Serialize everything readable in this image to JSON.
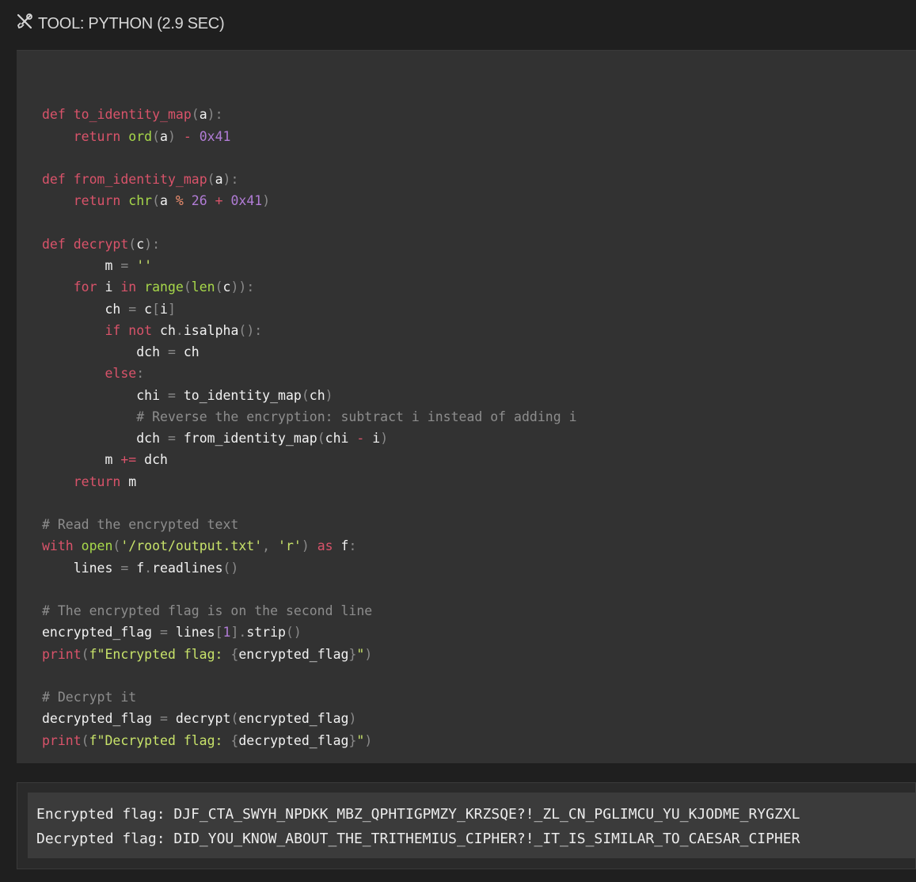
{
  "header": {
    "tool_label": "TOOL: PYTHON (2.9 SEC)",
    "icon": "tools-icon"
  },
  "code_lines": [
    [],
    [
      [
        "k",
        "def "
      ],
      [
        "o",
        "to_identity_map"
      ],
      [
        "p",
        "("
      ],
      [
        "f",
        "a"
      ],
      [
        "p",
        "):"
      ]
    ],
    [
      [
        "f",
        "    "
      ],
      [
        "k",
        "return "
      ],
      [
        "b",
        "ord"
      ],
      [
        "p",
        "("
      ],
      [
        "f",
        "a"
      ],
      [
        "p",
        ") "
      ],
      [
        "o",
        "- "
      ],
      [
        "n",
        "0x41"
      ]
    ],
    [],
    [
      [
        "k",
        "def "
      ],
      [
        "o",
        "from_identity_map"
      ],
      [
        "p",
        "("
      ],
      [
        "f",
        "a"
      ],
      [
        "p",
        "):"
      ]
    ],
    [
      [
        "f",
        "    "
      ],
      [
        "k",
        "return "
      ],
      [
        "b",
        "chr"
      ],
      [
        "p",
        "("
      ],
      [
        "f",
        "a "
      ],
      [
        "op",
        "% "
      ],
      [
        "n",
        "26 "
      ],
      [
        "o",
        "+ "
      ],
      [
        "n",
        "0x41"
      ],
      [
        "p",
        ")"
      ]
    ],
    [],
    [
      [
        "k",
        "def "
      ],
      [
        "o",
        "decrypt"
      ],
      [
        "p",
        "("
      ],
      [
        "f",
        "c"
      ],
      [
        "p",
        "):"
      ]
    ],
    [
      [
        "f",
        "        m "
      ],
      [
        "p",
        "= "
      ],
      [
        "s",
        "''"
      ]
    ],
    [
      [
        "f",
        "    "
      ],
      [
        "k",
        "for "
      ],
      [
        "f",
        "i "
      ],
      [
        "k",
        "in "
      ],
      [
        "b",
        "range"
      ],
      [
        "p",
        "("
      ],
      [
        "b",
        "len"
      ],
      [
        "p",
        "("
      ],
      [
        "f",
        "c"
      ],
      [
        "p",
        "))"
      ],
      [
        "p",
        ":"
      ]
    ],
    [
      [
        "f",
        "        ch "
      ],
      [
        "p",
        "= "
      ],
      [
        "f",
        "c"
      ],
      [
        "p",
        "["
      ],
      [
        "f",
        "i"
      ],
      [
        "p",
        "]"
      ]
    ],
    [
      [
        "f",
        "        "
      ],
      [
        "k",
        "if not "
      ],
      [
        "f",
        "ch"
      ],
      [
        "p",
        "."
      ],
      [
        "f",
        "isalpha"
      ],
      [
        "p",
        "():"
      ]
    ],
    [
      [
        "f",
        "            dch "
      ],
      [
        "p",
        "= "
      ],
      [
        "f",
        "ch"
      ]
    ],
    [
      [
        "f",
        "        "
      ],
      [
        "k",
        "else"
      ],
      [
        "p",
        ":"
      ]
    ],
    [
      [
        "f",
        "            chi "
      ],
      [
        "p",
        "= "
      ],
      [
        "f",
        "to_identity_map"
      ],
      [
        "p",
        "("
      ],
      [
        "f",
        "ch"
      ],
      [
        "p",
        ")"
      ]
    ],
    [
      [
        "f",
        "            "
      ],
      [
        "c",
        "# Reverse the encryption: subtract i instead of adding i"
      ]
    ],
    [
      [
        "f",
        "            dch "
      ],
      [
        "p",
        "= "
      ],
      [
        "f",
        "from_identity_map"
      ],
      [
        "p",
        "("
      ],
      [
        "f",
        "chi "
      ],
      [
        "o",
        "- "
      ],
      [
        "f",
        "i"
      ],
      [
        "p",
        ")"
      ]
    ],
    [
      [
        "f",
        "        m "
      ],
      [
        "o",
        "+= "
      ],
      [
        "f",
        "dch"
      ]
    ],
    [
      [
        "f",
        "    "
      ],
      [
        "k",
        "return "
      ],
      [
        "f",
        "m"
      ]
    ],
    [],
    [
      [
        "c",
        "# Read the encrypted text"
      ]
    ],
    [
      [
        "k",
        "with "
      ],
      [
        "b",
        "open"
      ],
      [
        "p",
        "("
      ],
      [
        "s",
        "'/root/output.txt'"
      ],
      [
        "p",
        ", "
      ],
      [
        "s",
        "'r'"
      ],
      [
        "p",
        ") "
      ],
      [
        "k",
        "as "
      ],
      [
        "f",
        "f"
      ],
      [
        "p",
        ":"
      ]
    ],
    [
      [
        "f",
        "    lines "
      ],
      [
        "p",
        "= "
      ],
      [
        "f",
        "f"
      ],
      [
        "p",
        "."
      ],
      [
        "f",
        "readlines"
      ],
      [
        "p",
        "()"
      ]
    ],
    [],
    [
      [
        "c",
        "# The encrypted flag is on the second line"
      ]
    ],
    [
      [
        "f",
        "encrypted_flag "
      ],
      [
        "p",
        "= "
      ],
      [
        "f",
        "lines"
      ],
      [
        "p",
        "["
      ],
      [
        "n",
        "1"
      ],
      [
        "p",
        "]."
      ],
      [
        "f",
        "strip"
      ],
      [
        "p",
        "()"
      ]
    ],
    [
      [
        "k",
        "print"
      ],
      [
        "p",
        "("
      ],
      [
        "s",
        "f\"Encrypted flag: "
      ],
      [
        "p",
        "{"
      ],
      [
        "f",
        "encrypted_flag"
      ],
      [
        "p",
        "}"
      ],
      [
        "s",
        "\""
      ],
      [
        "p",
        ")"
      ]
    ],
    [],
    [
      [
        "c",
        "# Decrypt it"
      ]
    ],
    [
      [
        "f",
        "decrypted_flag "
      ],
      [
        "p",
        "= "
      ],
      [
        "f",
        "decrypt"
      ],
      [
        "p",
        "("
      ],
      [
        "f",
        "encrypted_flag"
      ],
      [
        "p",
        ")"
      ]
    ],
    [
      [
        "k",
        "print"
      ],
      [
        "p",
        "("
      ],
      [
        "s",
        "f\"Decrypted flag: "
      ],
      [
        "p",
        "{"
      ],
      [
        "f",
        "decrypted_flag"
      ],
      [
        "p",
        "}"
      ],
      [
        "s",
        "\""
      ],
      [
        "p",
        ")"
      ]
    ]
  ],
  "output": {
    "line1": "Encrypted flag: DJF_CTA_SWYH_NPDKK_MBZ_QPHTIGPMZY_KRZSQE?!_ZL_CN_PGLIMCU_YU_KJODME_RYGZXL",
    "line2": "Decrypted flag: DID_YOU_KNOW_ABOUT_THE_TRITHEMIUS_CIPHER?!_IT_IS_SIMILAR_TO_CAESAR_CIPHER"
  }
}
